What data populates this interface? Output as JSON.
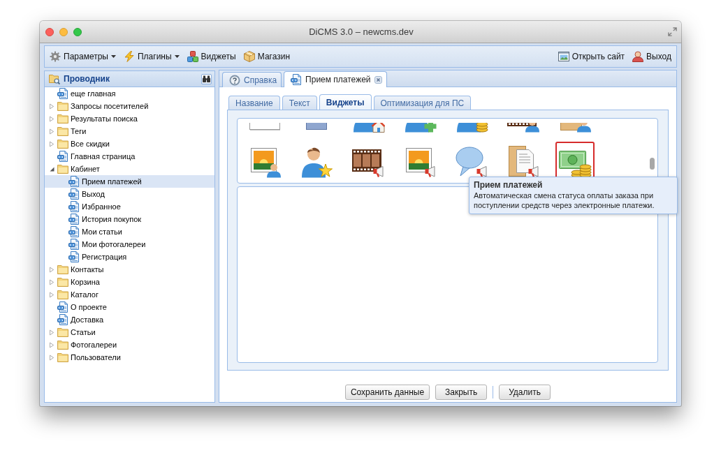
{
  "window": {
    "title": "DiCMS 3.0 – newcms.dev"
  },
  "toolbar": {
    "left": [
      {
        "kind": "settings",
        "label": "Параметры",
        "dropdown": true
      },
      {
        "kind": "plugins",
        "label": "Плагины",
        "dropdown": true
      },
      {
        "kind": "widgets",
        "label": "Виджеты",
        "dropdown": false
      },
      {
        "kind": "shop",
        "label": "Магазин",
        "dropdown": false
      }
    ],
    "right": [
      {
        "kind": "site",
        "label": "Открыть сайт",
        "dropdown": false
      },
      {
        "kind": "logout",
        "label": "Выход",
        "dropdown": false
      }
    ]
  },
  "sidebar": {
    "title": "Проводник",
    "tree": [
      {
        "kind": "page",
        "label": "еще главная",
        "selected": false
      },
      {
        "kind": "folder",
        "label": "Запросы посетителей",
        "expanded": false,
        "selected": false
      },
      {
        "kind": "folder",
        "label": "Результаты поиска",
        "expanded": false,
        "selected": false
      },
      {
        "kind": "folder",
        "label": "Теги",
        "expanded": false,
        "selected": false
      },
      {
        "kind": "folder",
        "label": "Все скидки",
        "expanded": false,
        "selected": false
      },
      {
        "kind": "page",
        "label": "Главная страница",
        "selected": false
      },
      {
        "kind": "folder",
        "label": "Кабинет",
        "expanded": true,
        "selected": false,
        "children": [
          {
            "kind": "page",
            "label": "Прием платежей",
            "selected": true
          },
          {
            "kind": "page",
            "label": "Выход",
            "selected": false
          },
          {
            "kind": "page",
            "label": "Избранное",
            "selected": false
          },
          {
            "kind": "page",
            "label": "История покупок",
            "selected": false
          },
          {
            "kind": "page",
            "label": "Мои статьи",
            "selected": false
          },
          {
            "kind": "page",
            "label": "Мои фотогалереи",
            "selected": false
          },
          {
            "kind": "page",
            "label": "Регистрация",
            "selected": false
          }
        ]
      },
      {
        "kind": "folder",
        "label": "Контакты",
        "expanded": false,
        "selected": false
      },
      {
        "kind": "folder",
        "label": "Корзина",
        "expanded": false,
        "selected": false
      },
      {
        "kind": "folder",
        "label": "Каталог",
        "expanded": false,
        "selected": false
      },
      {
        "kind": "page",
        "label": "О проекте",
        "selected": false
      },
      {
        "kind": "page",
        "label": "Доставка",
        "selected": false
      },
      {
        "kind": "folder",
        "label": "Статьи",
        "expanded": false,
        "selected": false
      },
      {
        "kind": "folder",
        "label": "Фотогалереи",
        "expanded": false,
        "selected": false
      },
      {
        "kind": "folder",
        "label": "Пользователи",
        "expanded": false,
        "selected": false
      }
    ]
  },
  "tabs": [
    {
      "kind": "help",
      "label": "Справка",
      "selected": false,
      "closable": false
    },
    {
      "kind": "page",
      "label": "Прием платежей",
      "selected": true,
      "closable": true
    }
  ],
  "editor": {
    "tabs": [
      {
        "label": "Название",
        "selected": false
      },
      {
        "label": "Текст",
        "selected": false
      },
      {
        "label": "Виджеты",
        "selected": true
      },
      {
        "label": "Оптимизация для ПС",
        "selected": false
      }
    ],
    "widgets": {
      "rows": [
        [
          {
            "kind": "sheet",
            "selected": false
          },
          {
            "kind": "panel",
            "selected": false
          },
          {
            "kind": "userhouse",
            "selected": false
          },
          {
            "kind": "useradd",
            "selected": false
          },
          {
            "kind": "usercoins",
            "selected": false
          },
          {
            "kind": "filmuser",
            "selected": false
          },
          {
            "kind": "folderuser",
            "selected": false
          }
        ],
        [
          {
            "kind": "photouser",
            "selected": false
          },
          {
            "kind": "userstar",
            "selected": false
          },
          {
            "kind": "filmads",
            "selected": false
          },
          {
            "kind": "photoads",
            "selected": false
          },
          {
            "kind": "bubbleads",
            "selected": false
          },
          {
            "kind": "docads",
            "selected": false
          },
          {
            "kind": "payment",
            "selected": true
          }
        ]
      ]
    },
    "tooltip": {
      "title": "Прием платежей",
      "text": "Автоматическая смена статуса оплаты заказа при поступлении средств через электронные платежи."
    },
    "button_groups": [
      [
        "Сохранить данные",
        "Закрыть"
      ],
      [
        "Удалить"
      ]
    ]
  }
}
